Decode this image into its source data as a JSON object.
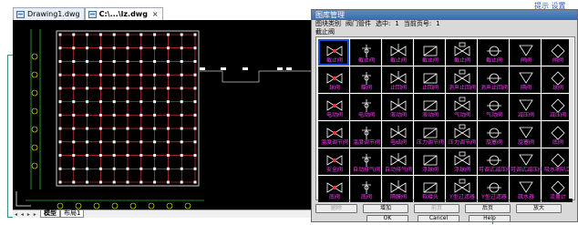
{
  "top_right_link": "提示 设置",
  "doc_tabs": [
    {
      "label": "Drawing1.dwg",
      "active": false
    },
    {
      "label": "C:\\...\\lz.dwg",
      "active": true
    }
  ],
  "model_tabs": {
    "nav": "◂ ◂ ▸ ▸",
    "model": "模型",
    "layout": "布局1"
  },
  "dialog": {
    "title": "图库管理",
    "info": {
      "category_label": "图块类别",
      "category_value": "阀门管件",
      "selected_label": "选中:",
      "selected_value": "1",
      "page_label": "当前页号:",
      "page_value": "1"
    },
    "current_category": "截止阀",
    "colors": {
      "accent": "#ff33ff",
      "symbol": "#ffffff",
      "selected": "#1e4fd8"
    },
    "cells": [
      {
        "label": "截止阀",
        "icon": "globe-valve-icon"
      },
      {
        "label": "截止阀",
        "icon": "angle-globe-valve-icon"
      },
      {
        "label": "截止阀",
        "icon": "globe-valve-icon"
      },
      {
        "label": "截止阀",
        "icon": "globe-valve-icon"
      },
      {
        "label": "截止阀",
        "icon": "gate-valve-icon"
      },
      {
        "label": "截止阀",
        "icon": "gate-valve-icon"
      },
      {
        "label": "闸阀",
        "icon": "gate-valve-icon"
      },
      {
        "label": "闸阀",
        "icon": "angle-valve-icon"
      },
      {
        "label": "球阀",
        "icon": "ball-valve-icon"
      },
      {
        "label": "蝶阀",
        "icon": "butterfly-valve-icon"
      },
      {
        "label": "止回阀",
        "icon": "check-valve-icon"
      },
      {
        "label": "止回阀",
        "icon": "check-valve-icon"
      },
      {
        "label": "消声止回阀",
        "icon": "silent-check-valve-icon"
      },
      {
        "label": "消声止回阀",
        "icon": "silent-check-valve-icon"
      },
      {
        "label": "隔阀",
        "icon": "gate-valve-icon"
      },
      {
        "label": "球阀",
        "icon": "ball-valve-icon"
      },
      {
        "label": "电动阀",
        "icon": "motor-valve-icon"
      },
      {
        "label": "电动阀",
        "icon": "motor-valve-icon"
      },
      {
        "label": "液动阀",
        "icon": "hydraulic-valve-icon"
      },
      {
        "label": "液动阀",
        "icon": "hydraulic-valve-icon"
      },
      {
        "label": "气动阀",
        "icon": "pneumatic-valve-icon"
      },
      {
        "label": "气动阀",
        "icon": "pneumatic-valve-icon"
      },
      {
        "label": "减压阀",
        "icon": "reducing-valve-icon"
      },
      {
        "label": "减压阀",
        "icon": "reducing-valve-icon"
      },
      {
        "label": "温度调节阀",
        "icon": "temp-valve-icon"
      },
      {
        "label": "温度调节阀",
        "icon": "temp-valve-icon"
      },
      {
        "label": "电磁阀",
        "icon": "solenoid-valve-icon"
      },
      {
        "label": "压力调节阀",
        "icon": "pressure-valve-icon"
      },
      {
        "label": "压力调节阀",
        "icon": "pressure-valve-icon"
      },
      {
        "label": "旋塞阀",
        "icon": "plug-valve-icon"
      },
      {
        "label": "旋塞阀",
        "icon": "plug-valve-icon"
      },
      {
        "label": "底阀",
        "icon": "foot-valve-icon"
      },
      {
        "label": "安全阀",
        "icon": "safety-valve-icon"
      },
      {
        "label": "自动排气阀",
        "icon": "air-vent-icon"
      },
      {
        "label": "自动排气阀",
        "icon": "air-vent-icon"
      },
      {
        "label": "浮球阀",
        "icon": "float-valve-icon"
      },
      {
        "label": "浮球阀",
        "icon": "float-valve-icon"
      },
      {
        "label": "可调式减压阀",
        "icon": "adj-reducing-valve-icon"
      },
      {
        "label": "可调式减压阀",
        "icon": "adj-reducing-valve-icon"
      },
      {
        "label": "吸水喇叭口",
        "icon": "bell-mouth-icon"
      },
      {
        "label": "底阀",
        "icon": "foot-valve-icon"
      },
      {
        "label": "底阀",
        "icon": "foot-valve-icon"
      },
      {
        "label": "隔膜阀",
        "icon": "diaphragm-valve-icon"
      },
      {
        "label": "软接头",
        "icon": "flex-joint-icon"
      },
      {
        "label": "Y型过滤器",
        "icon": "y-strainer-icon"
      },
      {
        "label": "Y型过滤器",
        "icon": "y-strainer-icon"
      },
      {
        "label": "疏水器",
        "icon": "steam-trap-icon"
      },
      {
        "label": "流量计",
        "icon": "flow-meter-icon"
      }
    ],
    "buttons_row1": [
      {
        "label": "删除",
        "disabled": true
      },
      {
        "label": "增加",
        "disabled": false
      },
      {
        "label": "前页",
        "disabled": true
      },
      {
        "label": "后页",
        "disabled": false
      },
      {
        "label": "放大",
        "disabled": false
      }
    ],
    "buttons_row2": [
      {
        "label": "OK"
      },
      {
        "label": "Cancel"
      },
      {
        "label": "Help"
      }
    ]
  }
}
